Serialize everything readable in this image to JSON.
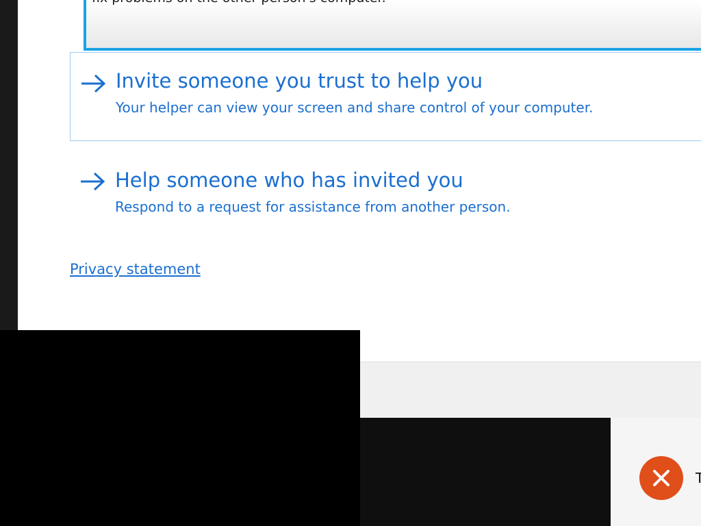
{
  "dialog": {
    "top_option_desc": "fix problems on the other person's computer.",
    "options": [
      {
        "title": "Invite someone you trust to help you",
        "description": "Your helper can view your screen and share control of your computer."
      },
      {
        "title": "Help someone who has invited you",
        "description": "Respond to a request for assistance from another person."
      }
    ],
    "privacy_link": "Privacy statement"
  },
  "notification": {
    "icon": "error-x-icon",
    "text": "T"
  },
  "colors": {
    "link_blue": "#1a6fd0",
    "selected_border": "#1aa3e6",
    "option_border": "#9ecbee",
    "error_orange": "#e04e1a"
  }
}
